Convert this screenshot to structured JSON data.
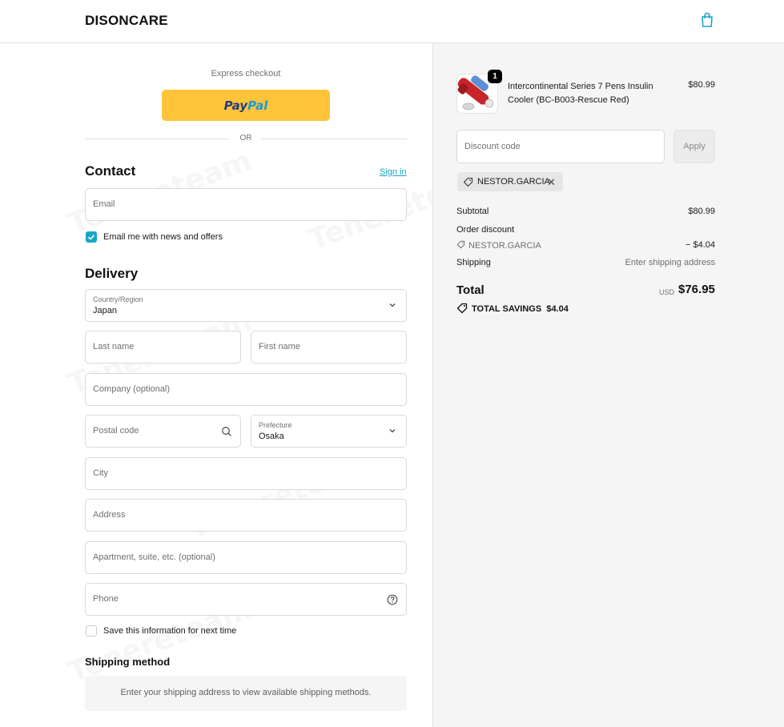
{
  "header": {
    "logo": "DISONCARE",
    "cart_icon": "shopping-bag-icon"
  },
  "express": {
    "label": "Express checkout",
    "paypal_part1": "Pay",
    "paypal_part2": "Pal",
    "or": "OR"
  },
  "contact": {
    "title": "Contact",
    "sign_in": "Sign in",
    "email_placeholder": "Email",
    "newsletter_label": "Email me with news and offers",
    "newsletter_checked": true
  },
  "delivery": {
    "title": "Delivery",
    "country_label": "Country/Region",
    "country_value": "Japan",
    "last_name_placeholder": "Last name",
    "first_name_placeholder": "First name",
    "company_placeholder": "Company (optional)",
    "postal_placeholder": "Postal code",
    "prefecture_label": "Prefecture",
    "prefecture_value": "Osaka",
    "city_placeholder": "City",
    "address_placeholder": "Address",
    "apartment_placeholder": "Apartment, suite, etc. (optional)",
    "phone_placeholder": "Phone",
    "save_info_label": "Save this information for next time",
    "save_info_checked": false
  },
  "shipping_method": {
    "title": "Shipping method",
    "notice": "Enter your shipping address to view available shipping methods."
  },
  "summary": {
    "product": {
      "quantity": "1",
      "name": "Intercontinental Series 7 Pens Insulin Cooler (BC-B003-Rescue Red)",
      "price": "$80.99"
    },
    "discount_placeholder": "Discount code",
    "apply_label": "Apply",
    "applied_code": "NESTOR.GARCIA",
    "subtotal_label": "Subtotal",
    "subtotal_value": "$80.99",
    "order_discount_label": "Order discount",
    "discount_code": "NESTOR.GARCIA",
    "discount_value": "− $4.04",
    "shipping_label": "Shipping",
    "shipping_value": "Enter shipping address",
    "total_label": "Total",
    "currency": "USD",
    "total_value": "$76.95",
    "savings_label": "TOTAL SAVINGS",
    "savings_value": "$4.04"
  },
  "watermark": "Tenereteam",
  "colors": {
    "accent": "#1aa6c6",
    "paypal_yellow": "#ffc439",
    "summary_bg": "#f5f5f5"
  }
}
